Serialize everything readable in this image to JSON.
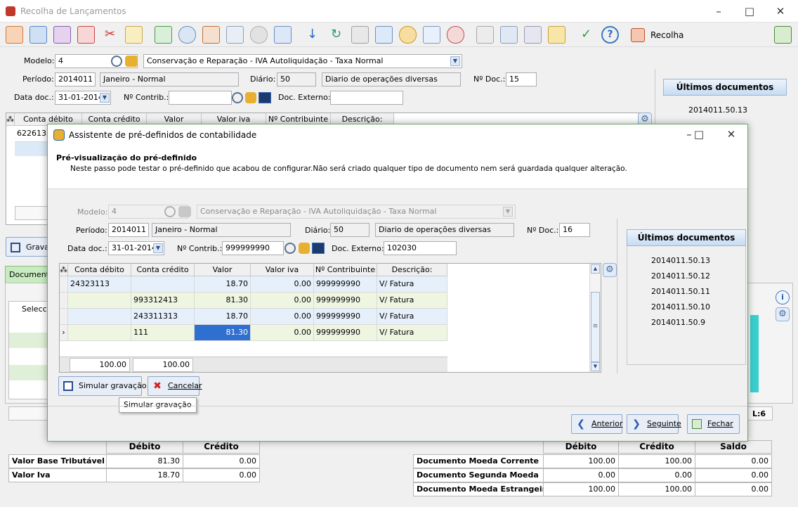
{
  "main": {
    "title": "Recolha de Lançamentos",
    "toolbar_recolha_label": "Recolha",
    "modelo_label": "Modelo:",
    "modelo_value": "4",
    "modelo_desc": "Conservação e Reparação - IVA Autoliquidação - Taxa Normal",
    "periodo_label": "Período:",
    "periodo_value": "2014011",
    "periodo_desc": "Janeiro - Normal",
    "diario_label": "Diário:",
    "diario_value": "50",
    "diario_desc": "Diario de operações diversas",
    "ndoc_label": "Nº Doc.:",
    "ndoc_value": "15",
    "datadoc_label": "Data doc.:",
    "datadoc_value": "31-01-2014",
    "ncontrib_label": "Nº Contrib.:",
    "ncontrib_value": "",
    "docext_label": "Doc. Externo:",
    "docext_value": "",
    "grid_headers": [
      "Conta débito",
      "Conta crédito",
      "Valor",
      "Valor iva",
      "Nº Contribuinte",
      "Descrição:"
    ],
    "grid_first_cell": "6226135",
    "ultimos_title": "Últimos documentos",
    "ultimos_first": "2014011.50.13",
    "grava_label": "Grava",
    "tab_documento": "Documento",
    "seleccio_label": "Seleccio",
    "status_l": "L:6"
  },
  "dialog": {
    "title": "Assistente de pré-definidos de contabilidade",
    "heading": "Pré-visualização do pré-definido",
    "subheading": "Neste passo pode testar o pré-definido que acabou de configurar.Não será criado qualquer tipo de documento nem será guardada qualquer alteração.",
    "modelo_label": "Modelo:",
    "modelo_value": "4",
    "modelo_desc": "Conservação e Reparação - IVA Autoliquidação - Taxa Normal",
    "periodo_label": "Período:",
    "periodo_value": "2014011",
    "periodo_desc": "Janeiro - Normal",
    "diario_label": "Diário:",
    "diario_value": "50",
    "diario_desc": "Diario de operações diversas",
    "ndoc_label": "Nº Doc.:",
    "ndoc_value": "16",
    "datadoc_label": "Data doc.:",
    "datadoc_value": "31-01-2014",
    "ncontrib_label": "Nº Contrib.:",
    "ncontrib_value": "999999990",
    "docext_label": "Doc. Externo:",
    "docext_value": "102030",
    "grid_headers": [
      "Conta débito",
      "Conta crédito",
      "Valor",
      "Valor iva",
      "Nº Contribuinte",
      "Descrição:"
    ],
    "rows": [
      {
        "debito": "24323113",
        "credito": "",
        "valor": "18.70",
        "iva": "0.00",
        "contrib": "999999990",
        "desc": "V/ Fatura"
      },
      {
        "debito": "",
        "credito": "993312413",
        "valor": "81.30",
        "iva": "0.00",
        "contrib": "999999990",
        "desc": "V/ Fatura"
      },
      {
        "debito": "",
        "credito": "243311313",
        "valor": "18.70",
        "iva": "0.00",
        "contrib": "999999990",
        "desc": "V/ Fatura"
      },
      {
        "debito": "",
        "credito": "111",
        "valor": "81.30",
        "iva": "0.00",
        "contrib": "999999990",
        "desc": "V/ Fatura"
      }
    ],
    "total_debito": "100.00",
    "total_credito": "100.00",
    "ultimos_title": "Últimos documentos",
    "ultimos_items": [
      "2014011.50.13",
      "2014011.50.12",
      "2014011.50.11",
      "2014011.50.10",
      "2014011.50.9"
    ],
    "simular_label": "Simular gravação",
    "cancelar_label": "Cancelar",
    "tooltip": "Simular gravação",
    "anterior_label": "Anterior",
    "seguinte_label": "Seguinte",
    "fechar_label": "Fechar"
  },
  "totals_left": {
    "debito_header": "Débito",
    "credito_header": "Crédito",
    "rows": [
      {
        "label": "Valor Base Tributável",
        "debito": "81.30",
        "credito": "0.00"
      },
      {
        "label": "Valor Iva",
        "debito": "18.70",
        "credito": "0.00"
      }
    ]
  },
  "totals_right": {
    "debito_header": "Débito",
    "credito_header": "Crédito",
    "saldo_header": "Saldo",
    "rows": [
      {
        "label": "Documento Moeda Corrente",
        "debito": "100.00",
        "credito": "100.00",
        "saldo": "0.00"
      },
      {
        "label": "Documento Segunda Moeda",
        "debito": "0.00",
        "credito": "0.00",
        "saldo": "0.00"
      },
      {
        "label": "Documento Moeda Estrangeira",
        "debito": "100.00",
        "credito": "100.00",
        "saldo": "0.00"
      }
    ]
  }
}
